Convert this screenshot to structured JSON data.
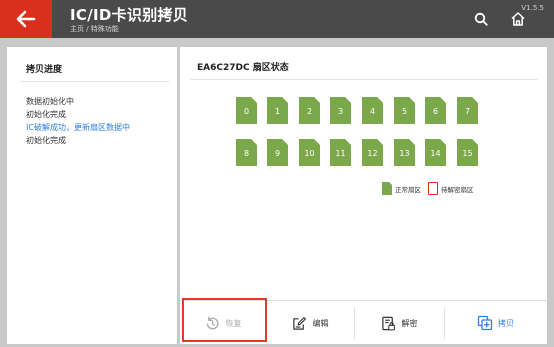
{
  "header": {
    "title": "IC/ID卡识别拷贝",
    "breadcrumb": "主页 / 特殊功能",
    "version": "V1.5.5"
  },
  "left_panel": {
    "title": "拷贝进度",
    "log": [
      "数据初始化中",
      "初始化完成",
      "IC破解成功，更新扇区数据中",
      "初始化完成"
    ]
  },
  "right_panel": {
    "title": "EA6C27DC 扇区状态",
    "sectors": [
      "0",
      "1",
      "2",
      "3",
      "4",
      "5",
      "6",
      "7",
      "8",
      "9",
      "10",
      "11",
      "12",
      "13",
      "14",
      "15"
    ],
    "legend_normal": "正常扇区",
    "legend_pending": "待解密扇区"
  },
  "toolbar": {
    "restore_label": "恢复",
    "edit_label": "编辑",
    "decrypt_label": "解密",
    "copy_label": "拷贝"
  },
  "colors": {
    "accent_red": "#d9301d",
    "sector_green": "#7aa84a",
    "link_blue": "#2f7de1",
    "header_bg": "#4a4a4a"
  }
}
